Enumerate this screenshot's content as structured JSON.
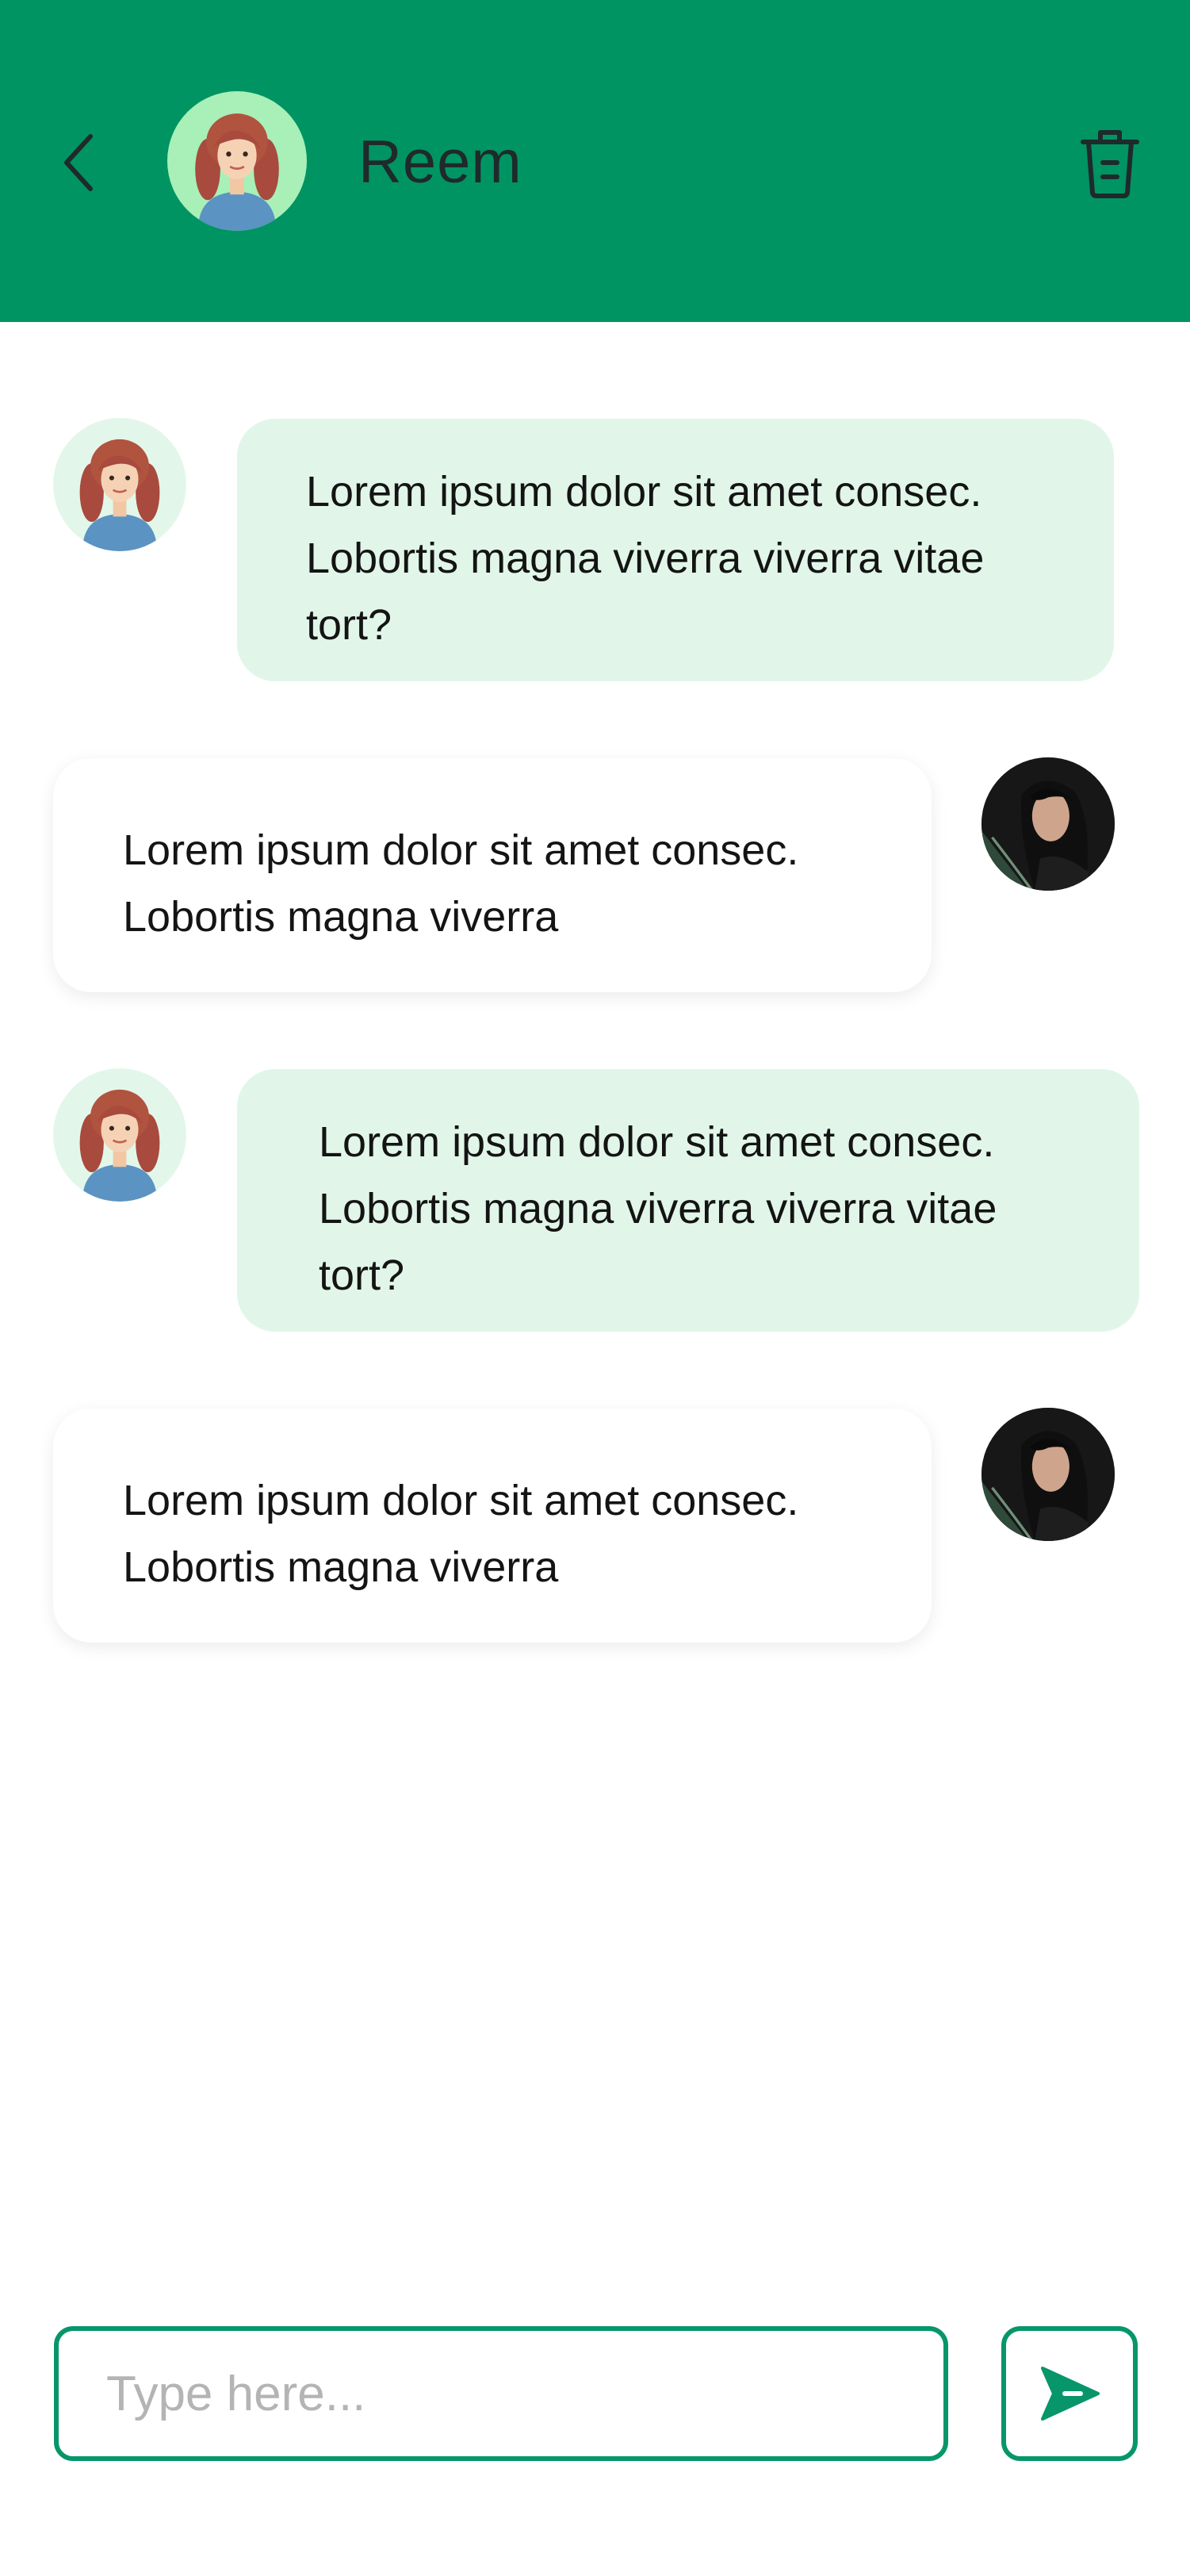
{
  "header": {
    "contact_name": "Reem",
    "back_icon": "chevron-left-icon",
    "delete_icon": "trash-icon",
    "background_color": "#009463"
  },
  "messages": [
    {
      "sender": "contact",
      "lines": [
        "Lorem ipsum dolor sit amet consec.",
        "Lobortis magna viverra viverra vitae",
        "tort?"
      ]
    },
    {
      "sender": "me",
      "lines": [
        "Lorem ipsum dolor sit amet consec.",
        "Lobortis magna viverra"
      ]
    },
    {
      "sender": "contact",
      "lines": [
        "Lorem ipsum dolor sit amet consec.",
        "Lobortis magna viverra viverra vitae",
        "tort?"
      ]
    },
    {
      "sender": "me",
      "lines": [
        "Lorem ipsum dolor sit amet consec.",
        "Lobortis magna viverra"
      ]
    }
  ],
  "composer": {
    "placeholder": "Type here...",
    "value": "",
    "send_icon": "send-icon"
  },
  "colors": {
    "accent": "#07966a",
    "incoming_bubble": "#e1f6e9",
    "outgoing_bubble": "#ffffff"
  }
}
